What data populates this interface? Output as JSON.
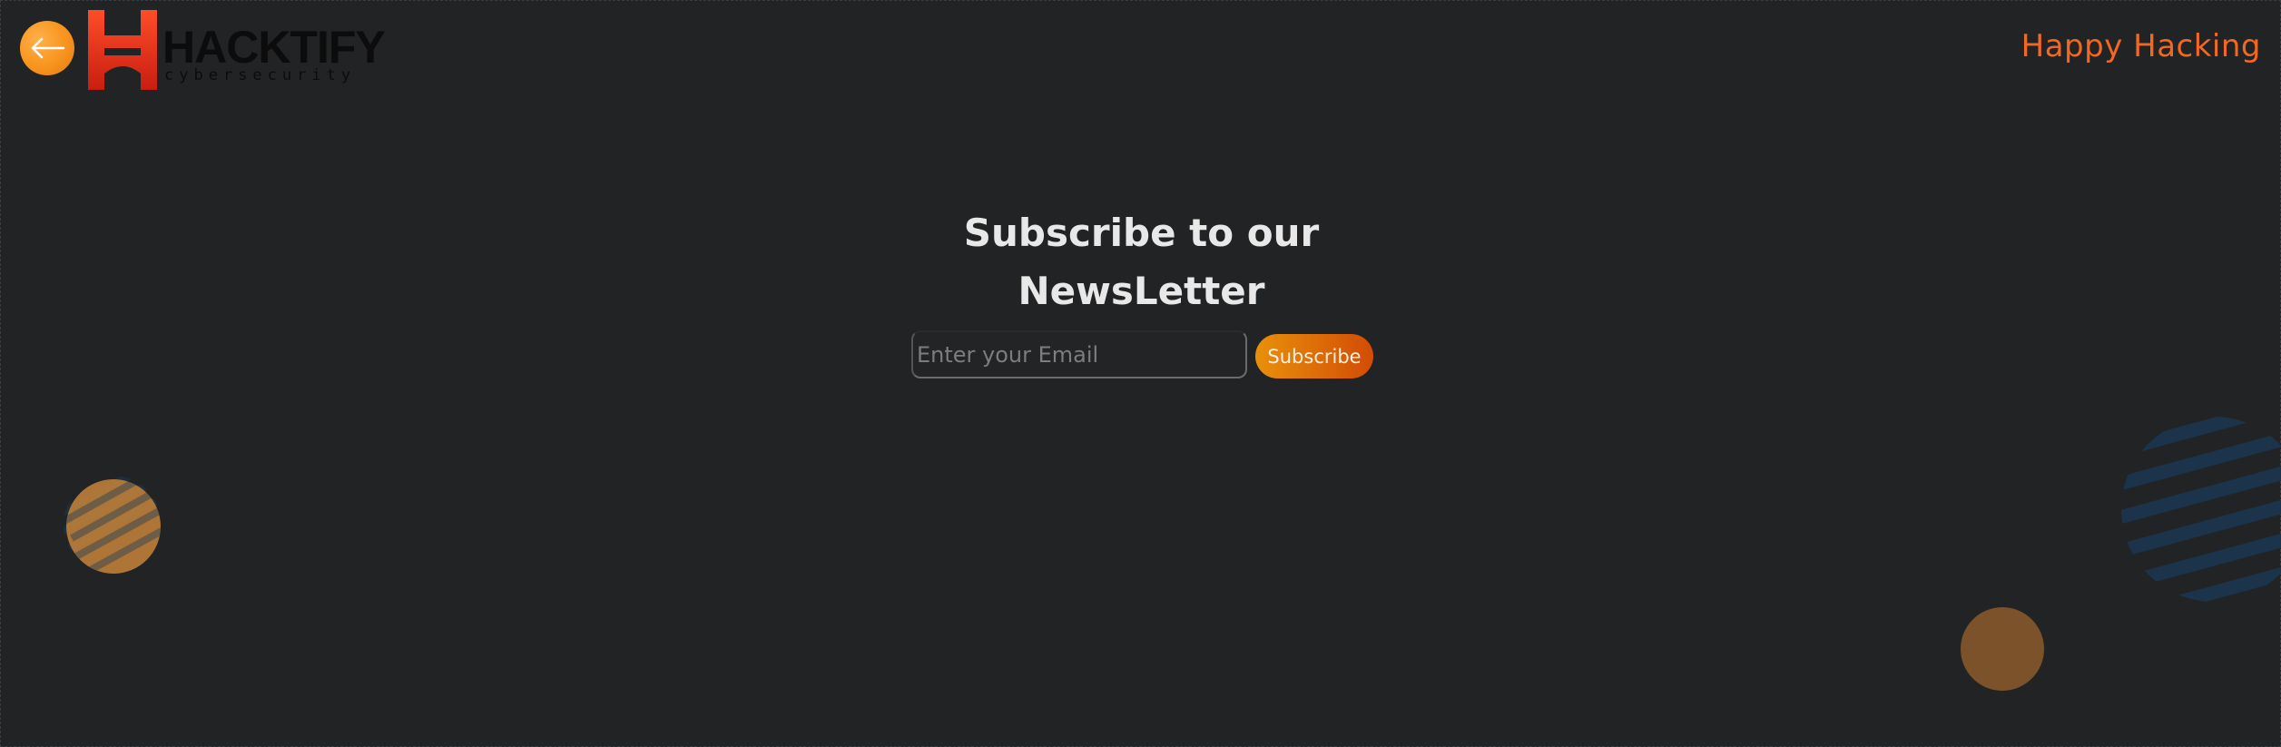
{
  "header": {
    "back_icon": "arrow-left-icon",
    "logo": {
      "wordmark": "HACKTIFY",
      "tagline": "cybersecurity"
    },
    "right_text": "Happy Hacking"
  },
  "newsletter": {
    "title_line1": "Subscribe to our",
    "title_line2": "NewsLetter",
    "email_placeholder": "Enter your Email",
    "email_value": "",
    "subscribe_label": "Subscribe"
  },
  "colors": {
    "background": "#212325",
    "accent_orange": "#f26722",
    "button_gradient_start": "#e9900b",
    "button_gradient_end": "#d24c05",
    "title_text": "#e8e8e8",
    "stripe_blue": "#1e3a55"
  }
}
